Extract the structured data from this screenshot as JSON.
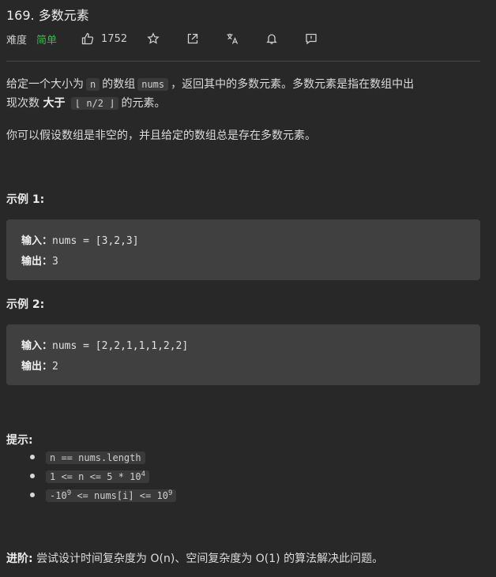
{
  "problem": {
    "title": "169. 多数元素",
    "difficulty_label": "难度",
    "difficulty": "简单",
    "likes": "1752"
  },
  "description": {
    "p1_a": "给定一个大小为",
    "p1_n": "n",
    "p1_b": "的数组",
    "p1_nums": "nums",
    "p1_c": "，返回其中的多数元素。多数元素是指在数组中出",
    "p1_d": "现次数",
    "p1_bold": "大于",
    "p1_floor": "⌊ n/2 ⌋",
    "p1_e": "的元素。",
    "p2": "你可以假设数组是非空的，并且给定的数组总是存在多数元素。"
  },
  "examples": [
    {
      "heading": "示例 1:",
      "input_label": "输入：",
      "input": "nums = [3,2,3]",
      "output_label": "输出：",
      "output": "3"
    },
    {
      "heading": "示例 2:",
      "input_label": "输入：",
      "input": "nums = [2,2,1,1,1,2,2]",
      "output_label": "输出：",
      "output": "2"
    }
  ],
  "hints": {
    "heading": "提示:",
    "h1": "n == nums.length",
    "h2_a": "1 <= n <= 5 * 10",
    "h2_sup": "4",
    "h3_a": "-10",
    "h3_sup1": "9",
    "h3_b": " <= nums[i] <= 10",
    "h3_sup2": "9"
  },
  "advanced": {
    "label": "进阶:",
    "text": "尝试设计时间复杂度为 O(n)、空间复杂度为 O(1) 的算法解决此问题。"
  },
  "icons": [
    "thumbs-up-icon",
    "star-icon",
    "share-icon",
    "translate-icon",
    "bell-icon",
    "feedback-icon"
  ],
  "colors": {
    "easy": "#3cb553",
    "background": "#282828",
    "code_block": "#404040"
  }
}
